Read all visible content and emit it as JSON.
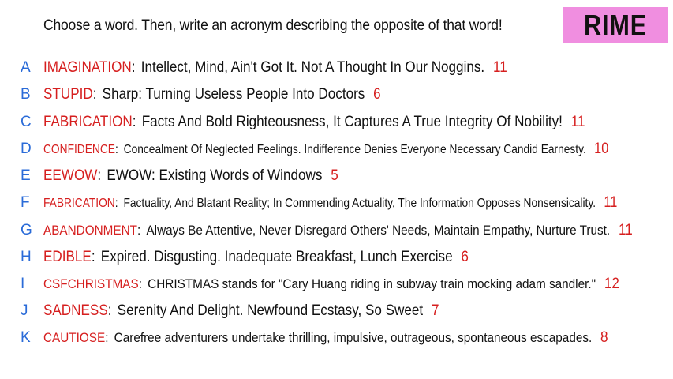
{
  "prompt": "Choose a word. Then, write an acronym describing the opposite of that word!",
  "logo": "RIME",
  "colors": {
    "letter": "#2a6bd8",
    "word": "#d61f1f",
    "count": "#d61f1f",
    "logo_bg": "#f08ee0"
  },
  "entries": [
    {
      "letter": "A",
      "word": "IMAGINATION",
      "acronym": "Intellect, Mind, Ain't Got It. Not A Thought In Our Noggins.",
      "count": "11"
    },
    {
      "letter": "B",
      "word": "STUPID",
      "acronym": "Sharp: Turning Useless People Into Doctors",
      "count": "6"
    },
    {
      "letter": "C",
      "word": "FABRICATION",
      "acronym": "Facts And Bold Righteousness, It Captures A True Integrity Of Nobility!",
      "count": "11"
    },
    {
      "letter": "D",
      "word": "CONFIDENCE",
      "acronym": "Concealment Of Neglected Feelings. Indifference Denies Everyone Necessary Candid Earnesty.",
      "count": "10"
    },
    {
      "letter": "E",
      "word": "EEWOW",
      "acronym": "EWOW: Existing Words of Windows",
      "count": "5"
    },
    {
      "letter": "F",
      "word": "FABRICATION",
      "acronym": "Factuality, And Blatant Reality; In Commending Actuality, The Information Opposes Nonsensicality.",
      "count": "11"
    },
    {
      "letter": "G",
      "word": "ABANDONMENT",
      "acronym": "Always Be Attentive, Never Disregard Others' Needs, Maintain Empathy, Nurture Trust.",
      "count": "11"
    },
    {
      "letter": "H",
      "word": "EDIBLE",
      "acronym": "Expired. Disgusting. Inadequate Breakfast, Lunch Exercise",
      "count": "6"
    },
    {
      "letter": "I",
      "word": "CSFCHRISTMAS",
      "acronym": "CHRISTMAS stands for \"Cary Huang riding in subway train mocking adam sandler.\"",
      "count": "12"
    },
    {
      "letter": "J",
      "word": "SADNESS",
      "acronym": "Serenity And Delight. Newfound Ecstasy, So Sweet",
      "count": "7"
    },
    {
      "letter": "K",
      "word": "CAUTIOSE",
      "acronym": "Carefree adventurers undertake thrilling, impulsive, outrageous, spontaneous escapades.",
      "count": "8"
    }
  ]
}
